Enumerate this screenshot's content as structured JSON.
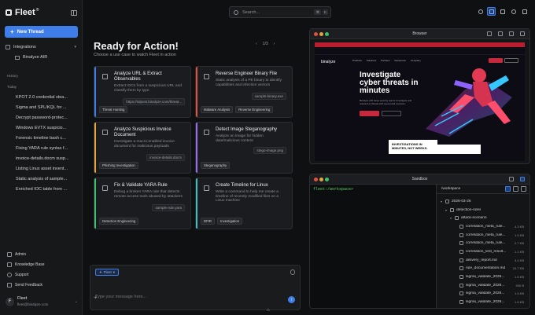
{
  "sidebar": {
    "logo": "Fleet",
    "logo_sup": "®",
    "new_thread": "New Thread",
    "integrations_label": "Integrations",
    "integration_items": [
      "Binalyze AIR"
    ],
    "history_label": "History",
    "today_label": "Today",
    "threads": [
      "KPOT 2.0 credential stea...",
      "Sigma and SPL/KQL for ...",
      "Decrypt password-protec...",
      "Windows EVTX suspicio...",
      "Forensic timeline bash c...",
      "Fixing YARA rule syntax f...",
      "invoice-details.docm susp...",
      "Listing Linux asset invent...",
      "Static analysis of sample...",
      "Enriched IOC table from ..."
    ],
    "bottom": [
      "Admin",
      "Knowledge Base",
      "Support",
      "Send Feedback"
    ],
    "user": {
      "initial": "F",
      "name": "Fleet",
      "email": "fleet@binalyze.com"
    }
  },
  "topbar": {
    "search_placeholder": "Search...",
    "kbd": [
      "⌘",
      "K"
    ]
  },
  "main": {
    "title": "Ready for Action!",
    "subtitle": "Choose a use case to watch Fleet in action",
    "pager": {
      "prev": "‹",
      "label": "1/3",
      "next": "›"
    },
    "cards": [
      {
        "title": "Analyze URL & Extract Observables",
        "desc": "Extract IOCs from a suspicious URL and classify them by type",
        "file": "https://sdpost.binalyze.com/threat...",
        "tags": [
          "Threat Hunting"
        ],
        "color": "#3f7ee8"
      },
      {
        "title": "Reverse Engineer Binary File",
        "desc": "Static analysis of a PE binary to identify capabilities and infection vectors",
        "file": "sample-binary.exe",
        "tags": [
          "Malware Analysis",
          "Reverse Engineering"
        ],
        "color": "#e0533d"
      },
      {
        "title": "Analyze Suspicious Invoice Document",
        "desc": "Investigate a macro-enabled invoice document for malicious payloads",
        "file": "invoice-details.docm",
        "tags": [
          "Phishing Investigation"
        ],
        "color": "#e8a23a"
      },
      {
        "title": "Detect Image Steganography",
        "desc": "Analyze an image for hidden data/malicious content",
        "file": "stego-image.png",
        "tags": [
          "Steganography"
        ],
        "color": "#9b6bf2"
      },
      {
        "title": "Fix & Validate YARA Rule",
        "desc": "Debug a broken YARA rule that detects remote access tools abused by attackers",
        "file": "sample-rule.yara",
        "tags": [
          "Detection Engineering"
        ],
        "color": "#3fbf6a"
      },
      {
        "title": "Create Timeline for Linux",
        "desc": "Write a command to help me create a timeline of recently modified files on a Linux machine",
        "file": "",
        "tags": [
          "DFIR",
          "Investigation"
        ],
        "color": "#3fbfbf"
      }
    ],
    "composer": {
      "agent": "Fleet",
      "placeholder": "Type your message here..."
    }
  },
  "browser": {
    "title": "Browser",
    "site": {
      "logo": "binalyze",
      "links": [
        "Products",
        "Solutions",
        "Partners",
        "Resources",
        "Company"
      ],
      "headline": "Investigate cyber threats in minutes",
      "body": "Binalyze AIR helps security teams investigate and respond to threats with speed and precision.",
      "banner": "INVESTIGATIONS IN MINUTES, NOT WEEKS."
    }
  },
  "sandbox": {
    "title": "Sandbox",
    "prompt": "fleet:/workspace>",
    "path": "/workspace",
    "tree": [
      {
        "name": "2026-03-26",
        "type": "folder",
        "level": 0,
        "size": ""
      },
      {
        "name": "detection-rules",
        "type": "folder",
        "level": 1,
        "size": ""
      },
      {
        "name": "attack-scenario",
        "type": "folder",
        "level": 2,
        "size": ""
      },
      {
        "name": "correlation_meta_rule...",
        "type": "file",
        "level": 3,
        "size": "4.3 KB"
      },
      {
        "name": "correlation_meta_rule...",
        "type": "file",
        "level": 3,
        "size": "1.5 KB"
      },
      {
        "name": "correlation_meta_rule...",
        "type": "file",
        "level": 3,
        "size": "2.7 KB"
      },
      {
        "name": "correlation_test_result...",
        "type": "file",
        "level": 3,
        "size": "1.1 KB"
      },
      {
        "name": "delivery_report.md",
        "type": "file",
        "level": 3,
        "size": "3.4 KB"
      },
      {
        "name": "rule_documentation.md",
        "type": "file",
        "level": 3,
        "size": "24.7 KB"
      },
      {
        "name": "sigma_validate_2026...",
        "type": "file",
        "level": 3,
        "size": "1.6 KB"
      },
      {
        "name": "sigma_validate_2026...",
        "type": "file",
        "level": 3,
        "size": "900 B"
      },
      {
        "name": "sigma_validate_2026...",
        "type": "file",
        "level": 3,
        "size": "1.5 KB"
      },
      {
        "name": "sigma_validate_2026...",
        "type": "file",
        "level": 3,
        "size": "1.6 KB"
      }
    ]
  }
}
